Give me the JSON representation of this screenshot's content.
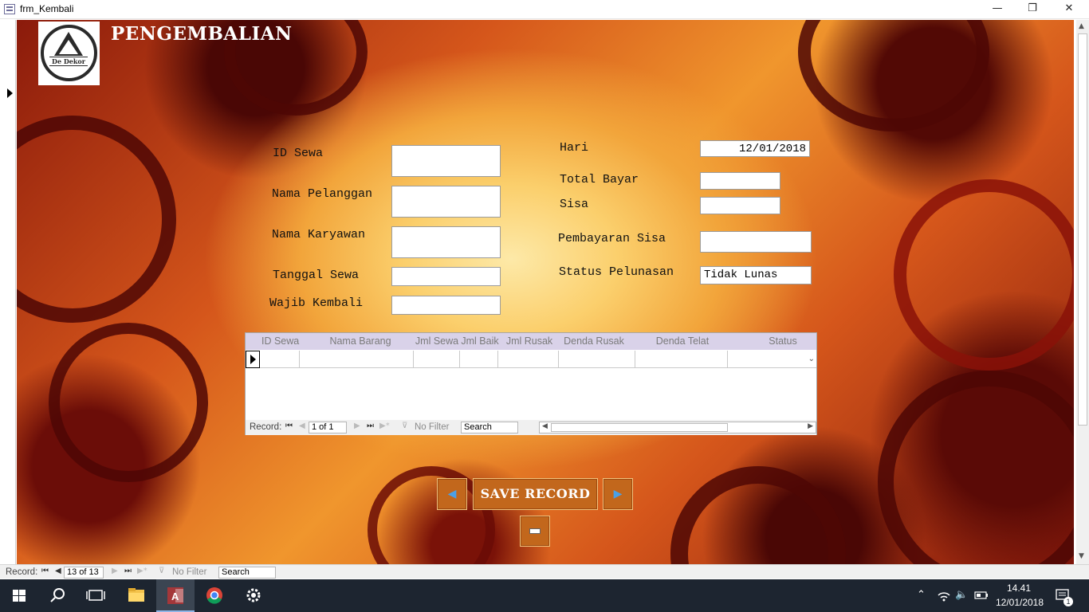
{
  "window": {
    "title": "frm_Kembali",
    "minimize_glyph": "—",
    "restore_glyph": "❐",
    "close_glyph": "✕"
  },
  "form": {
    "title": "PENGEMBALIAN",
    "logo_text": "De Dekor",
    "left_fields": [
      {
        "label": "ID Sewa",
        "value": ""
      },
      {
        "label": "Nama Pelanggan",
        "value": ""
      },
      {
        "label": "Nama Karyawan",
        "value": ""
      },
      {
        "label": "Tanggal Sewa",
        "value": ""
      },
      {
        "label": "Wajib Kembali",
        "value": ""
      }
    ],
    "right_fields": [
      {
        "label": "Hari",
        "value": "12/01/2018"
      },
      {
        "label": "Total Bayar",
        "value": ""
      },
      {
        "label": "Sisa",
        "value": ""
      },
      {
        "label": "Pembayaran Sisa",
        "value": ""
      },
      {
        "label": "Status Pelunasan",
        "value": "Tidak Lunas"
      }
    ]
  },
  "subform": {
    "columns": [
      "ID Sewa",
      "Nama Barang",
      "Jml Sewa",
      "Jml Baik",
      "Jml Rusak",
      "Denda Rusak",
      "Denda Telat",
      "Status"
    ],
    "navigator": {
      "record_label": "Record:",
      "position": "1 of 1",
      "filter_label": "No Filter",
      "search_placeholder": "Search",
      "first": "⏮",
      "prev": "◀",
      "next": "▶",
      "last": "⏭",
      "new": "▶*"
    }
  },
  "buttons": {
    "prev_glyph": "◀",
    "save_label": "SAVE RECORD",
    "next_glyph": "▶"
  },
  "main_navigator": {
    "record_label": "Record:",
    "position": "13 of 13",
    "filter_label": "No Filter",
    "search_placeholder": "Search",
    "first": "⏮",
    "prev": "◀",
    "next": "▶",
    "last": "⏭",
    "new": "▶*"
  },
  "taskbar": {
    "time": "14.41",
    "date": "12/01/2018",
    "notification_count": "1",
    "access_icon_text": "A"
  }
}
